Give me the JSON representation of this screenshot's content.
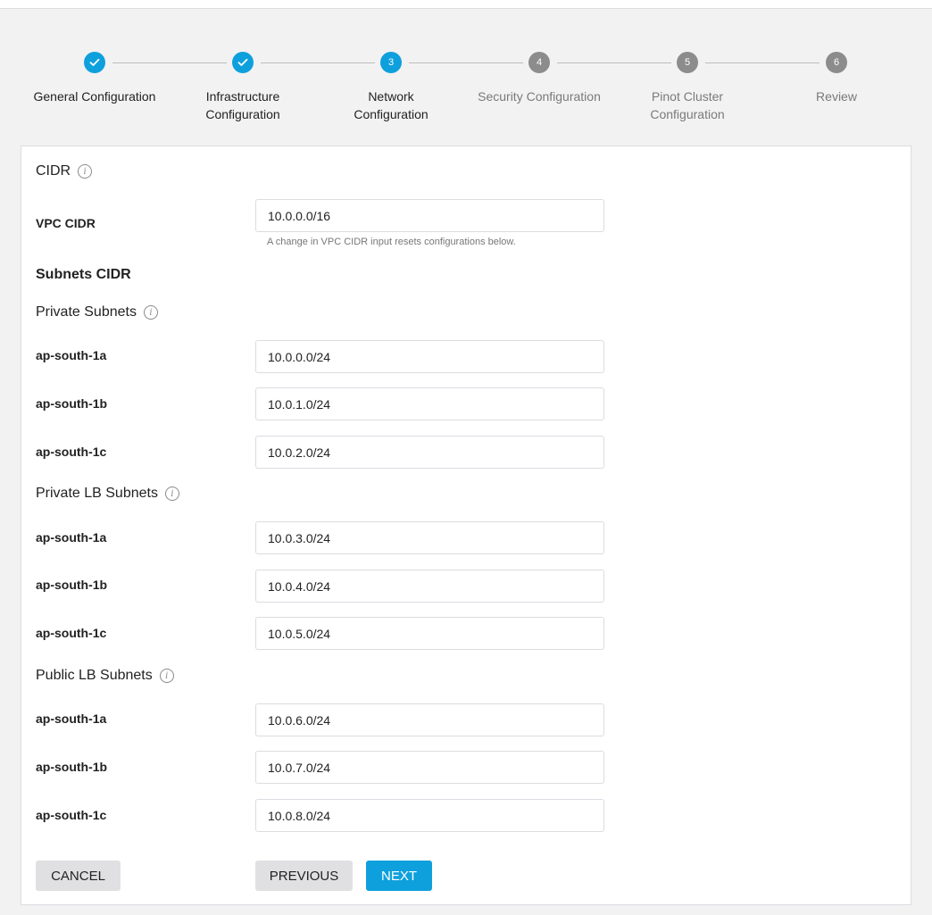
{
  "stepper": {
    "steps": [
      {
        "number": "1",
        "label": "General Configuration",
        "state": "done",
        "icon": "check-icon"
      },
      {
        "number": "2",
        "label": "Infrastructure Configuration",
        "state": "done",
        "icon": "check-icon"
      },
      {
        "number": "3",
        "label": "Network Configuration",
        "state": "active"
      },
      {
        "number": "4",
        "label": "Security Configuration",
        "state": "pending"
      },
      {
        "number": "5",
        "label": "Pinot Cluster Configuration",
        "state": "pending"
      },
      {
        "number": "6",
        "label": "Review",
        "state": "pending"
      }
    ],
    "colors": {
      "active": "#0ea0dc",
      "pending": "#8c8c8c"
    }
  },
  "form": {
    "cidr_title": "CIDR",
    "vpc_cidr": {
      "label": "VPC CIDR",
      "value": "10.0.0.0/16",
      "hint": "A change in VPC CIDR input resets configurations below."
    },
    "subnets_title": "Subnets CIDR",
    "groups": [
      {
        "title": "Private Subnets",
        "rows": [
          {
            "zone": "ap-south-1a",
            "value": "10.0.0.0/24"
          },
          {
            "zone": "ap-south-1b",
            "value": "10.0.1.0/24"
          },
          {
            "zone": "ap-south-1c",
            "value": "10.0.2.0/24"
          }
        ]
      },
      {
        "title": "Private LB Subnets",
        "rows": [
          {
            "zone": "ap-south-1a",
            "value": "10.0.3.0/24"
          },
          {
            "zone": "ap-south-1b",
            "value": "10.0.4.0/24"
          },
          {
            "zone": "ap-south-1c",
            "value": "10.0.5.0/24"
          }
        ]
      },
      {
        "title": "Public LB Subnets",
        "rows": [
          {
            "zone": "ap-south-1a",
            "value": "10.0.6.0/24"
          },
          {
            "zone": "ap-south-1b",
            "value": "10.0.7.0/24"
          },
          {
            "zone": "ap-south-1c",
            "value": "10.0.8.0/24"
          }
        ]
      }
    ]
  },
  "actions": {
    "cancel": "CANCEL",
    "previous": "PREVIOUS",
    "next": "NEXT"
  }
}
